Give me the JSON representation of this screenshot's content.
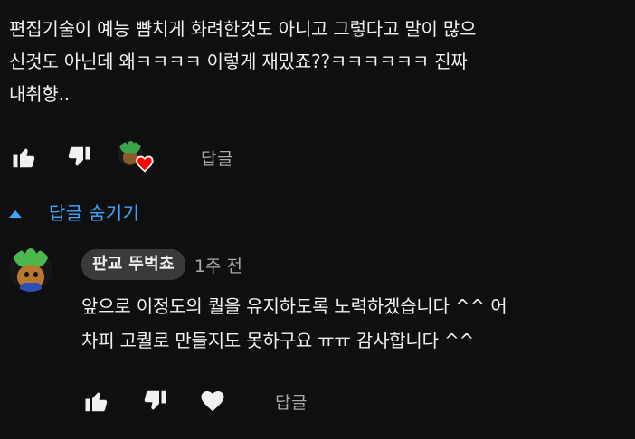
{
  "comment": {
    "text_lines": [
      "편집기술이 예능 뺨치게 화려한것도 아니고 그렇다고 말이 많으",
      "신것도 아닌데 왜ㅋㅋㅋㅋ 이렇게 재밌죠??ㅋㅋㅋㅋㅋㅋ 진짜",
      "내취향.."
    ],
    "actions": {
      "like_icon": "thumb-up-icon",
      "dislike_icon": "thumb-down-icon",
      "creator_heart_icon": "creator-heart-icon",
      "reply_label": "답글"
    }
  },
  "replies_toggle": {
    "icon": "caret-up-icon",
    "label": "답글 숨기기"
  },
  "reply": {
    "author": "판교 뚜벅쵸",
    "timestamp": "1주 전",
    "text_lines": [
      "앞으로 이정도의 퀄을 유지하도록 노력하겠습니다 ^^ 어",
      "차피 고퀄로 만들지도 못하구요 ㅠㅠ 감사합니다 ^^"
    ],
    "actions": {
      "like_icon": "thumb-up-icon",
      "dislike_icon": "thumb-down-icon",
      "heart_icon": "heart-icon",
      "reply_label": "답글"
    }
  },
  "colors": {
    "background": "#0f0f0f",
    "text": "#f1f1f1",
    "muted": "#aaaaaa",
    "accent_blue": "#3ea6ff",
    "heart_red": "#ff0000",
    "author_chip": "#3a3a3a"
  }
}
